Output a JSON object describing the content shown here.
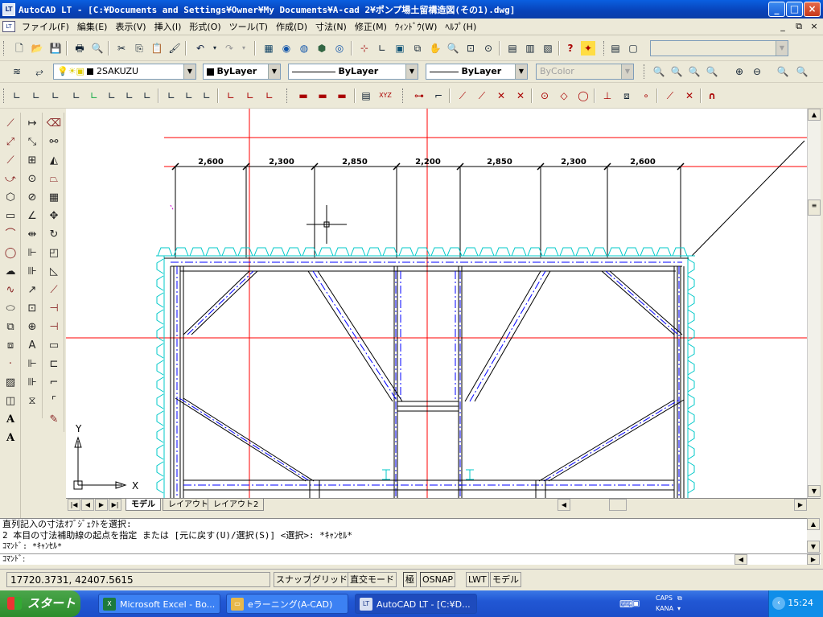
{
  "window": {
    "title": "AutoCAD LT - [C:¥Documents and Settings¥Owner¥My Documents¥A-cad 2¥ポンプ場土留構造図(その1).dwg]",
    "app_icon": "LT",
    "buttons": [
      "_",
      "□",
      "×"
    ]
  },
  "menu": {
    "items": [
      "ファイル(F)",
      "編集(E)",
      "表示(V)",
      "挿入(I)",
      "形式(O)",
      "ツール(T)",
      "作成(D)",
      "寸法(N)",
      "修正(M)",
      "ｳｨﾝﾄﾞｳ(W)",
      "ﾍﾙﾌﾟ(H)"
    ],
    "mdi_buttons": [
      "_",
      "⧉",
      "×"
    ]
  },
  "layer_toolbar": {
    "layer": "2SAKUZU",
    "color": "ByLayer",
    "linetype": "ByLayer",
    "lineweight": "ByLayer",
    "plotstyle": "ByColor"
  },
  "drawing": {
    "dimensions": [
      "2,600",
      "2,300",
      "2,850",
      "2,200",
      "2,850",
      "2,300",
      "2,600"
    ],
    "ucs_x": "X",
    "ucs_y": "Y"
  },
  "layout_tabs": [
    "モデル",
    "レイアウト1",
    "レイアウト2"
  ],
  "command": {
    "history": [
      "直列記入の寸法ｵﾌﾞｼﾞｪｸﾄを選択:",
      "2 本目の寸法補助線の起点を指定 または [元に戻す(U)/選択(S)] <選択>: *ｷｬﾝｾﾙ*",
      "ｺﾏﾝﾄﾞ: *ｷｬﾝｾﾙ*"
    ],
    "prompt": "ｺﾏﾝﾄﾞ:"
  },
  "status": {
    "coords": "17720.3731, 42407.5615",
    "toggles": [
      "スナップ",
      "グリッド",
      "直交モード",
      "極",
      "OSNAP",
      "LWT",
      "モデル"
    ]
  },
  "taskbar": {
    "start": "スタート",
    "tasks": [
      "Microsoft Excel - Bo...",
      "eラーニング(A-CAD)",
      "AutoCAD LT - [C:¥D..."
    ],
    "ime": [
      "CAPS",
      "KANA"
    ],
    "clock": "15:24"
  },
  "colors": {
    "red_line": "#ff0000",
    "cyan": "#00c8c8",
    "blue_center": "#0000ff"
  }
}
